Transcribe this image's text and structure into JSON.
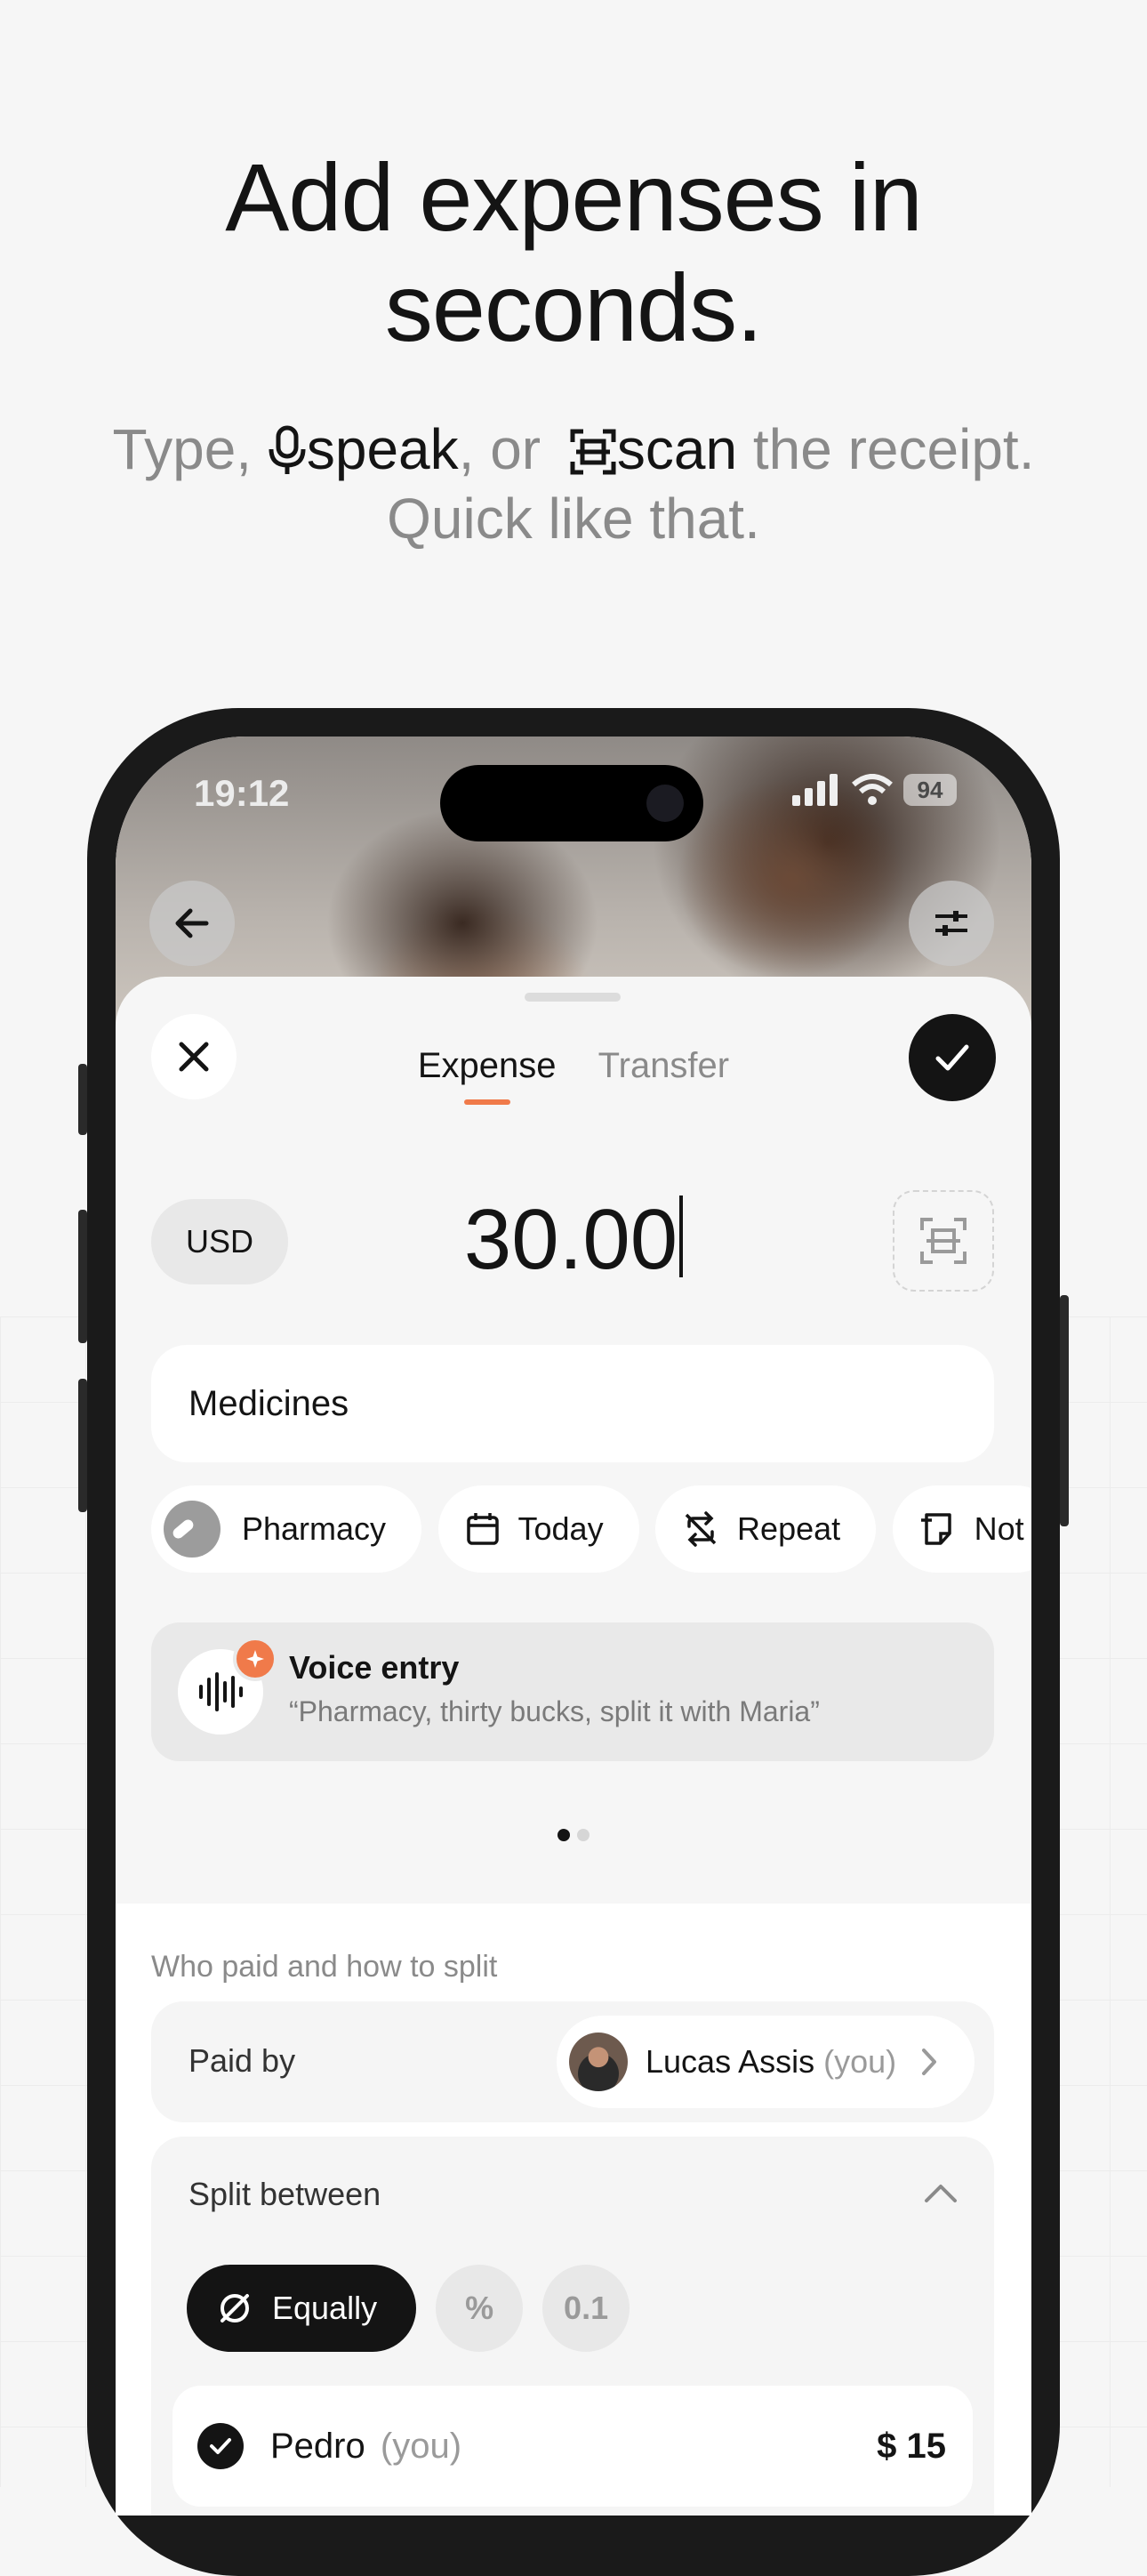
{
  "headline": {
    "line1": "Add expenses in",
    "line2": "seconds."
  },
  "subline": {
    "type_word": "Type,",
    "speak_word": "speak",
    "or_word": ", or",
    "scan_word": "scan",
    "rest": "the receipt.",
    "line2": "Quick like that."
  },
  "status_bar": {
    "time": "19:12",
    "battery": "94"
  },
  "sheet": {
    "tabs": [
      {
        "label": "Expense",
        "active": true
      },
      {
        "label": "Transfer",
        "active": false
      }
    ],
    "currency": "USD",
    "amount": "30.00",
    "description": "Medicines",
    "chips": [
      {
        "label": "Pharmacy",
        "icon": "pill-icon"
      },
      {
        "label": "Today",
        "icon": "calendar-icon"
      },
      {
        "label": "Repeat",
        "icon": "repeat-off-icon"
      },
      {
        "label": "Not",
        "icon": "note-icon"
      }
    ],
    "voice_entry": {
      "title": "Voice entry",
      "quote": "“Pharmacy, thirty bucks, split it with Maria”"
    },
    "pager": {
      "count": 2,
      "active": 0
    },
    "split_section": {
      "label": "Who paid and how to split",
      "paid_by_label": "Paid by",
      "payer_name": "Lucas Assis",
      "payer_you": "(you)",
      "split_between_label": "Split between",
      "modes": [
        {
          "label": "Equally",
          "icon": "equal-slash-icon",
          "active": true
        },
        {
          "label": "%",
          "icon": "percent-icon",
          "active": false
        },
        {
          "label": "0.1",
          "icon": "decimal-icon",
          "active": false
        }
      ],
      "members": [
        {
          "name": "Pedro",
          "you": "(you)",
          "amount": "$ 15",
          "checked": true
        }
      ]
    }
  },
  "colors": {
    "accent": "#f07a4a",
    "dark": "#141414",
    "background": "#f6f6f6"
  }
}
